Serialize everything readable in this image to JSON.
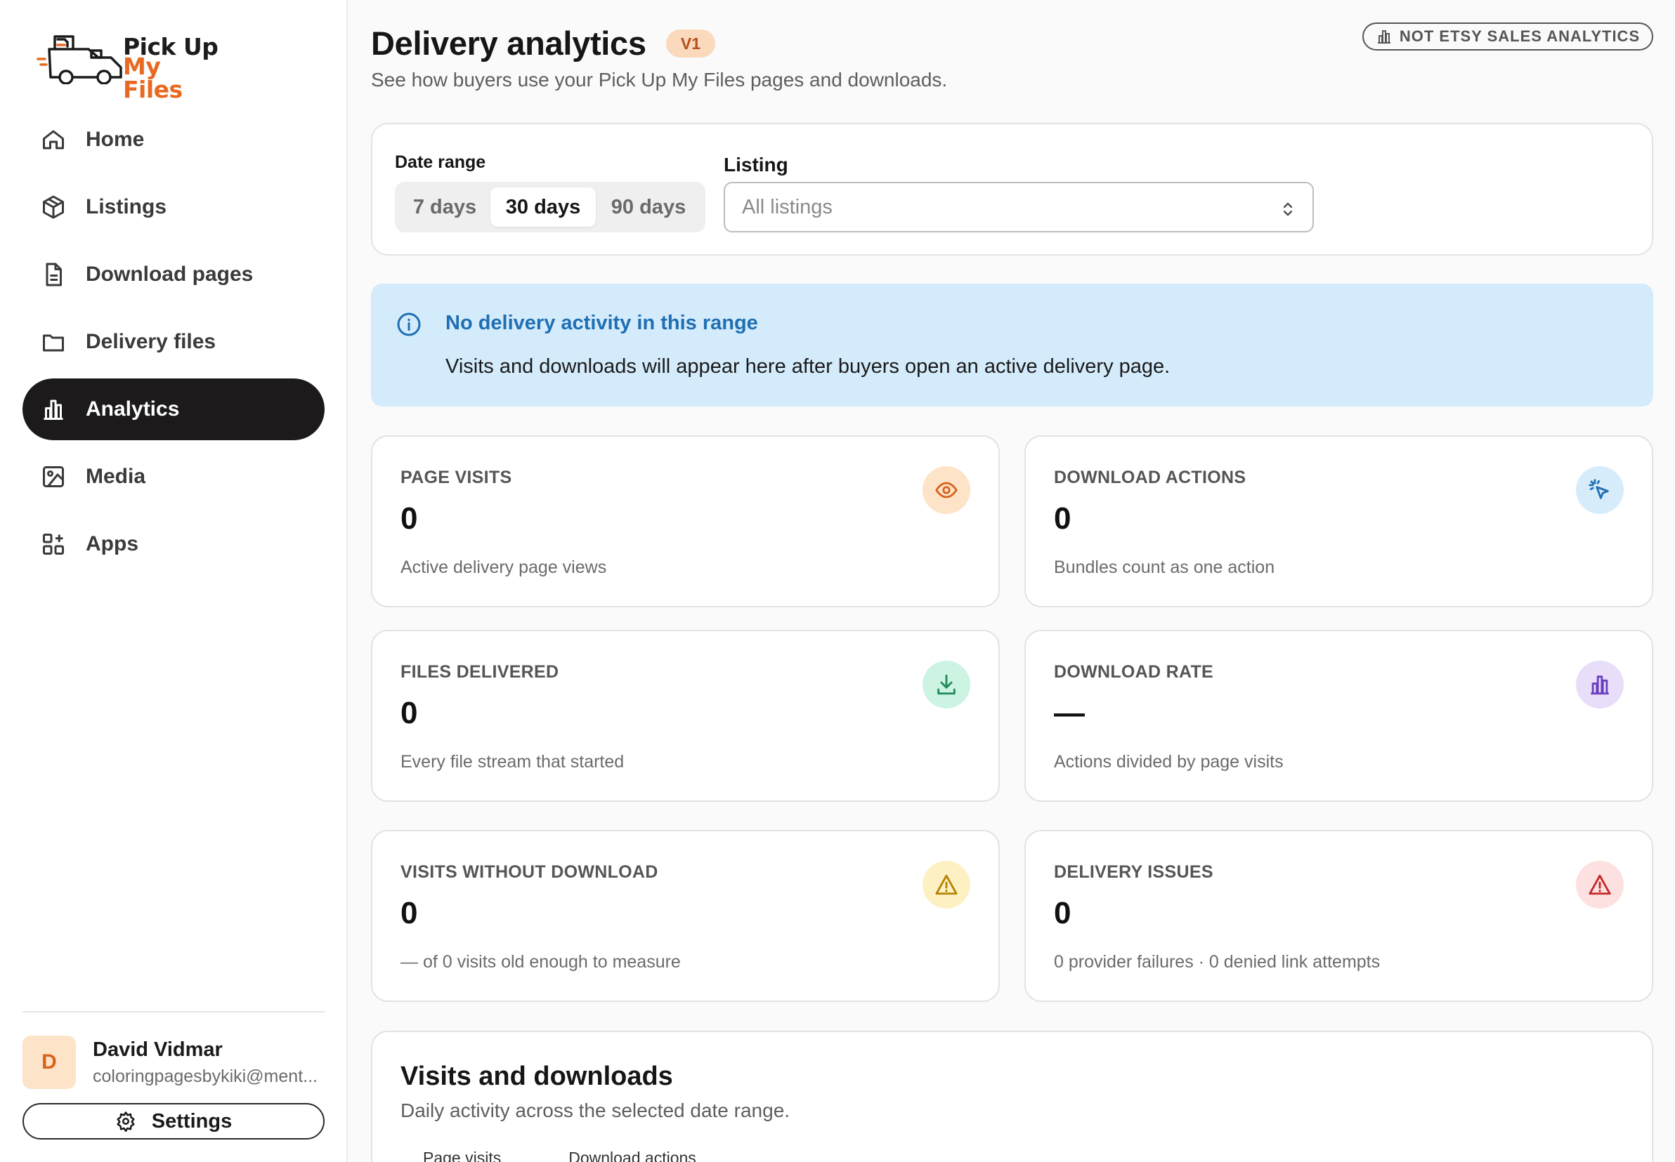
{
  "app": {
    "logo_line1": "Pick Up",
    "logo_line2": "My Files",
    "brand_color": "#e86a22"
  },
  "sidebar": {
    "items": [
      {
        "label": "Home",
        "icon": "home-icon",
        "active": false
      },
      {
        "label": "Listings",
        "icon": "box-icon",
        "active": false
      },
      {
        "label": "Download pages",
        "icon": "document-icon",
        "active": false
      },
      {
        "label": "Delivery files",
        "icon": "folder-icon",
        "active": false
      },
      {
        "label": "Analytics",
        "icon": "bar-chart-icon",
        "active": true
      },
      {
        "label": "Media",
        "icon": "image-icon",
        "active": false
      },
      {
        "label": "Apps",
        "icon": "apps-grid-icon",
        "active": false
      }
    ],
    "user": {
      "initial": "D",
      "name": "David Vidmar",
      "email": "coloringpagesbykiki@ment..."
    },
    "settings_label": "Settings"
  },
  "header": {
    "title": "Delivery analytics",
    "badge": "V1",
    "subtitle": "See how buyers use your Pick Up My Files pages and downloads.",
    "etsy_pill": "NOT ETSY SALES ANALYTICS"
  },
  "filters": {
    "date_range_label": "Date range",
    "ranges": [
      "7 days",
      "30 days",
      "90 days"
    ],
    "selected_range": "30 days",
    "listing_label": "Listing",
    "listing_value": "All listings"
  },
  "notice": {
    "title": "No delivery activity in this range",
    "body": "Visits and downloads will appear here after buyers open an active delivery page."
  },
  "stats": [
    {
      "label": "PAGE VISITS",
      "value": "0",
      "desc": "Active delivery page views",
      "icon": "eye-icon",
      "icon_bg": "#fde3c8",
      "icon_color": "#d8631d"
    },
    {
      "label": "DOWNLOAD ACTIONS",
      "value": "0",
      "desc": "Bundles count as one action",
      "icon": "cursor-click-icon",
      "icon_bg": "#d6ecfb",
      "icon_color": "#1f6fb3"
    },
    {
      "label": "FILES DELIVERED",
      "value": "0",
      "desc": "Every file stream that started",
      "icon": "download-icon",
      "icon_bg": "#cdf3e3",
      "icon_color": "#1f8a5a"
    },
    {
      "label": "DOWNLOAD RATE",
      "value": "—",
      "desc": "Actions divided by page visits",
      "icon": "bar-chart-icon",
      "icon_bg": "#e8defa",
      "icon_color": "#6a3fbf"
    },
    {
      "label": "VISITS WITHOUT DOWNLOAD",
      "value": "0",
      "desc": "— of 0 visits old enough to measure",
      "icon": "warning-icon",
      "icon_bg": "#fdf1c4",
      "icon_color": "#b58300"
    },
    {
      "label": "DELIVERY ISSUES",
      "value": "0",
      "desc": "0 provider failures · 0 denied link attempts",
      "icon": "alert-triangle-icon",
      "icon_bg": "#fde0e0",
      "icon_color": "#c62828"
    }
  ],
  "chart_section": {
    "title": "Visits and downloads",
    "subtitle": "Daily activity across the selected date range.",
    "legend": [
      "Page visits",
      "Download actions"
    ]
  }
}
